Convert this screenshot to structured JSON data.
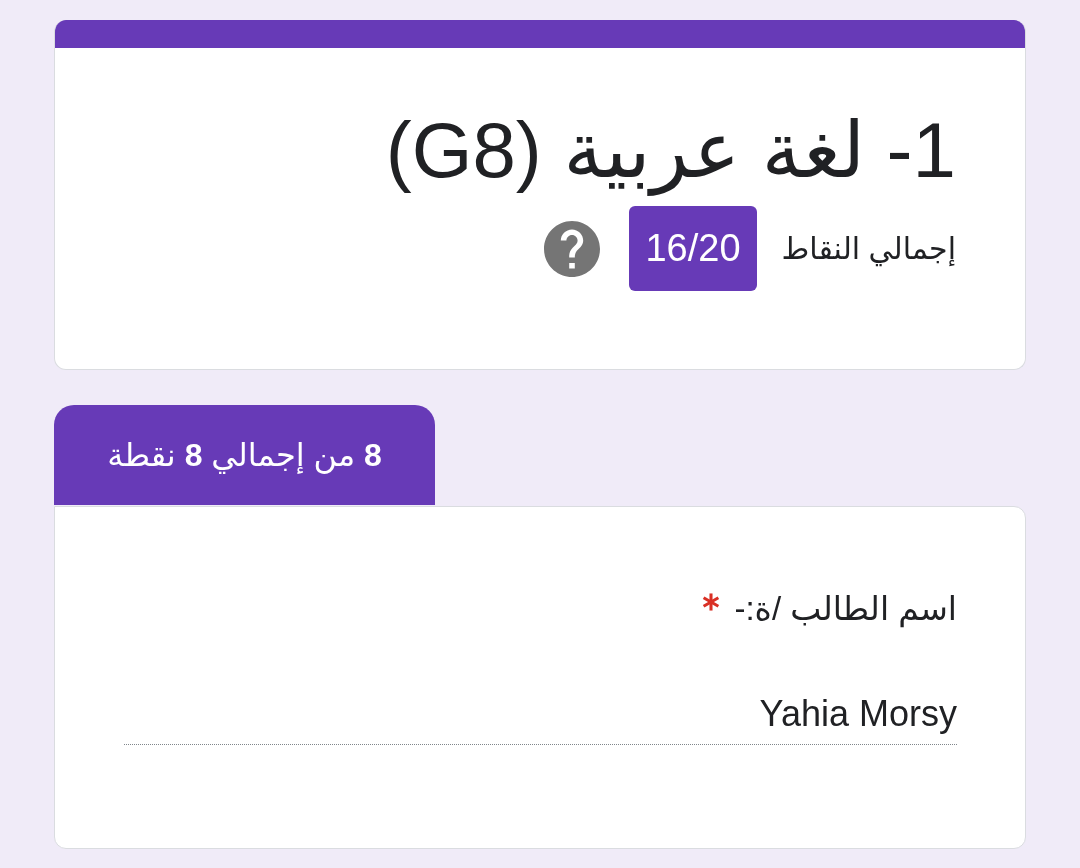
{
  "header": {
    "title": "1- لغة عربية (G8)",
    "score_label": "إجمالي النقاط",
    "score": "16/20"
  },
  "section": {
    "points": "**8** من إجمالي **8** نقطة",
    "questions": [
      {
        "label": "اسم الطالب /ة:-",
        "required": true,
        "answer": "Yahia Morsy"
      }
    ]
  }
}
